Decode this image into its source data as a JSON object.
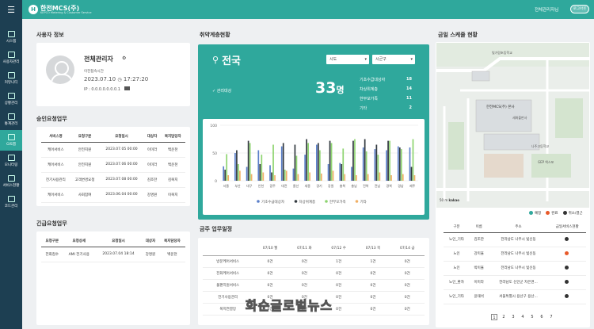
{
  "header": {
    "logo_mark": "H",
    "logo_text": "한전MCS(주)",
    "logo_sub": "KEPCO Metering & Customer Service",
    "admin_name": "전체관리자님",
    "logout": "로그아웃"
  },
  "sidebar": {
    "items": [
      {
        "label": "시스템",
        "icon": "system-icon"
      },
      {
        "label": "사용자관리",
        "icon": "user-manage-icon"
      },
      {
        "label": "커뮤니티",
        "icon": "community-icon"
      },
      {
        "label": "상황관리",
        "icon": "situation-icon"
      },
      {
        "label": "통계관리",
        "icon": "statistics-icon"
      },
      {
        "label": "GIS맵",
        "icon": "gis-map-icon"
      },
      {
        "label": "모니터링",
        "icon": "monitoring-icon"
      },
      {
        "label": "서비스현황",
        "icon": "service-status-icon"
      },
      {
        "label": "코드관리",
        "icon": "code-manage-icon"
      }
    ]
  },
  "user_info": {
    "title": "사용자 정보",
    "name": "전체관리자",
    "last_access_label": "이전접속시간",
    "date": "2023.07.10",
    "time": "17:27:20",
    "ip": "IP : 0.0.0.0.0.0.0.1"
  },
  "approval": {
    "title": "승인요청업무",
    "headers": [
      "서비스명",
      "요청구분",
      "요청일시",
      "대상자",
      "복지담당자"
    ],
    "rows": [
      [
        "케어서비스",
        "안전지원",
        "2023.07.05 00:00",
        "이미라",
        "백운천"
      ],
      [
        "케어서비스",
        "안전지원",
        "2023.07.06 00:00",
        "이미라",
        "백운천"
      ],
      [
        "전기사용관리",
        "고객변경요청",
        "2023.07.08 00:00",
        "김조한",
        "김복지"
      ],
      [
        "케어서비스",
        "사회참여",
        "2023.06.04 00:00",
        "강명원",
        "이복지"
      ]
    ]
  },
  "urgent": {
    "title": "긴급요청업무",
    "headers": [
      "요청구분",
      "요청상세",
      "요청일시",
      "대상자",
      "복지담당자"
    ],
    "rows": [
      [
        "전화접수",
        "AMI 전기사용",
        "2023.07.04 18:14",
        "강명원",
        "백운천"
      ]
    ]
  },
  "vulnerable": {
    "title": "취약계층현황",
    "region": "전국",
    "select1": "시도",
    "select2": "시군구",
    "checkbox_label": "관리대상",
    "total_value": "33",
    "total_unit": "명",
    "stats": [
      {
        "label": "기초수급대상자",
        "value": "18"
      },
      {
        "label": "차상위계층",
        "value": "14"
      },
      {
        "label": "한부모가족",
        "value": "11"
      },
      {
        "label": "기타",
        "value": "2"
      }
    ]
  },
  "chart_data": {
    "type": "bar",
    "categories": [
      "서울",
      "부산",
      "대구",
      "인천",
      "광주",
      "대전",
      "울산",
      "세종",
      "경기",
      "강원",
      "충북",
      "충남",
      "전북",
      "전남",
      "경북",
      "경남",
      "제주"
    ],
    "series": [
      {
        "name": "기초수급대상자",
        "color": "#5b7fc9",
        "values": [
          26,
          50,
          25,
          55,
          28,
          62,
          22,
          47,
          65,
          30,
          32,
          25,
          60,
          57,
          55,
          62,
          60
        ]
      },
      {
        "name": "차상위계층",
        "color": "#333a40",
        "values": [
          20,
          55,
          72,
          30,
          15,
          68,
          65,
          75,
          68,
          72,
          30,
          72,
          75,
          65,
          72,
          60,
          25
        ]
      },
      {
        "name": "한부모가족",
        "color": "#8ed470",
        "values": [
          48,
          30,
          68,
          47,
          65,
          20,
          45,
          68,
          55,
          68,
          58,
          75,
          53,
          47,
          72,
          57,
          75
        ]
      },
      {
        "name": "기타",
        "color": "#f0b066",
        "values": [
          10,
          18,
          12,
          15,
          10,
          18,
          12,
          15,
          13,
          18,
          12,
          10,
          12,
          15,
          10,
          12,
          10
        ]
      }
    ],
    "ylim": [
      0,
      100
    ],
    "yticks": [
      "100",
      "50",
      "0"
    ]
  },
  "schedule": {
    "title": "금주 업무일정",
    "headers": [
      "",
      "07/10 월",
      "07/11 화",
      "07/12 수",
      "07/13 목",
      "07/14 금"
    ],
    "rows": [
      [
        "방문케어서비스",
        "0건",
        "0건",
        "1건",
        "1건",
        "0건"
      ],
      [
        "전화케어서비스",
        "0건",
        "0건",
        "0건",
        "0건",
        "0건"
      ],
      [
        "불편지원서비스",
        "0건",
        "0건",
        "0건",
        "0건",
        "0건"
      ],
      [
        "전기사용관리",
        "0건",
        "0건",
        "0건",
        "0건",
        "0건"
      ],
      [
        "복지연결망",
        "0건",
        "0건",
        "0건",
        "0건",
        "0건"
      ]
    ]
  },
  "today_schedule": {
    "title": "금일 스케줄 현황",
    "legend": [
      {
        "label": "예정",
        "color": "#2fa89c"
      },
      {
        "label": "완료",
        "color": "#e85a2a"
      },
      {
        "label": "취소/결근",
        "color": "#333333"
      }
    ],
    "headers": [
      "구분",
      "이름",
      "주소",
      "금일서비스현황"
    ],
    "rows": [
      [
        "노인_기타",
        "김조한",
        "전라남도 나주시 빛신동"
      ],
      [
        "노인",
        "강미율",
        "전라남도 나주시 빛신동"
      ],
      [
        "노인",
        "박이율",
        "전라남도 나주시 빛신동"
      ],
      [
        "노인_환자",
        "이미라",
        "전라남도 신안군 자은면..."
      ],
      [
        "노인_기타",
        "윤태석",
        "서울특별시 용산구 용산..."
      ]
    ],
    "pages": [
      "1",
      "2",
      "3",
      "4",
      "5",
      "6",
      "7"
    ]
  },
  "map_labels": {
    "scale": "50 m",
    "brand": "kakao",
    "places": [
      "한전MCS(주) 본사",
      "세화출판사",
      "GEP 엑스포",
      "나주고등학교",
      "빛가람초등학교"
    ]
  },
  "watermark": "화순글로벌뉴스"
}
